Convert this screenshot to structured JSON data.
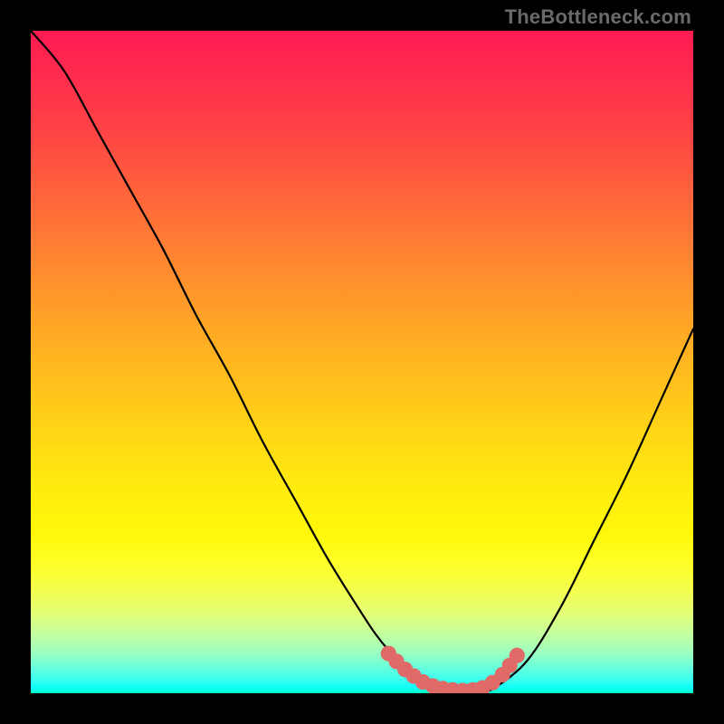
{
  "attribution": "TheBottleneck.com",
  "colors": {
    "background": "#000000",
    "curve": "#000000",
    "marker_fill": "#e06a67",
    "marker_stroke": "#e06a67"
  },
  "chart_data": {
    "type": "line",
    "title": "",
    "xlabel": "",
    "ylabel": "",
    "xlim": [
      0,
      100
    ],
    "ylim": [
      0,
      100
    ],
    "grid": false,
    "legend": false,
    "x": [
      0,
      5,
      10,
      15,
      20,
      25,
      30,
      35,
      40,
      45,
      50,
      52,
      54,
      56,
      58,
      60,
      62,
      64,
      66,
      68,
      70,
      75,
      80,
      85,
      90,
      95,
      100
    ],
    "y": [
      100,
      94,
      85,
      76,
      67,
      57,
      48,
      38,
      29,
      20,
      12,
      9,
      6.5,
      4.5,
      3,
      2,
      1.2,
      0.8,
      0.5,
      0.4,
      0.8,
      5,
      13,
      23,
      33,
      44,
      55
    ],
    "series": [
      {
        "name": "bottleneck-curve",
        "x": [
          0,
          5,
          10,
          15,
          20,
          25,
          30,
          35,
          40,
          45,
          50,
          52,
          54,
          56,
          58,
          60,
          62,
          64,
          66,
          68,
          70,
          75,
          80,
          85,
          90,
          95,
          100
        ],
        "y": [
          100,
          94,
          85,
          76,
          67,
          57,
          48,
          38,
          29,
          20,
          12,
          9,
          6.5,
          4.5,
          3,
          2,
          1.2,
          0.8,
          0.5,
          0.4,
          0.8,
          5,
          13,
          23,
          33,
          44,
          55
        ]
      }
    ],
    "markers": [
      {
        "x": 54.0,
        "y": 6.0
      },
      {
        "x": 55.2,
        "y": 4.8
      },
      {
        "x": 56.5,
        "y": 3.6
      },
      {
        "x": 57.8,
        "y": 2.6
      },
      {
        "x": 59.2,
        "y": 1.7
      },
      {
        "x": 60.7,
        "y": 1.1
      },
      {
        "x": 62.2,
        "y": 0.7
      },
      {
        "x": 63.7,
        "y": 0.5
      },
      {
        "x": 65.2,
        "y": 0.4
      },
      {
        "x": 66.7,
        "y": 0.5
      },
      {
        "x": 68.2,
        "y": 0.8
      },
      {
        "x": 69.7,
        "y": 1.6
      },
      {
        "x": 71.2,
        "y": 2.8
      },
      {
        "x": 72.3,
        "y": 4.2
      },
      {
        "x": 73.4,
        "y": 5.7
      }
    ],
    "annotations": []
  }
}
